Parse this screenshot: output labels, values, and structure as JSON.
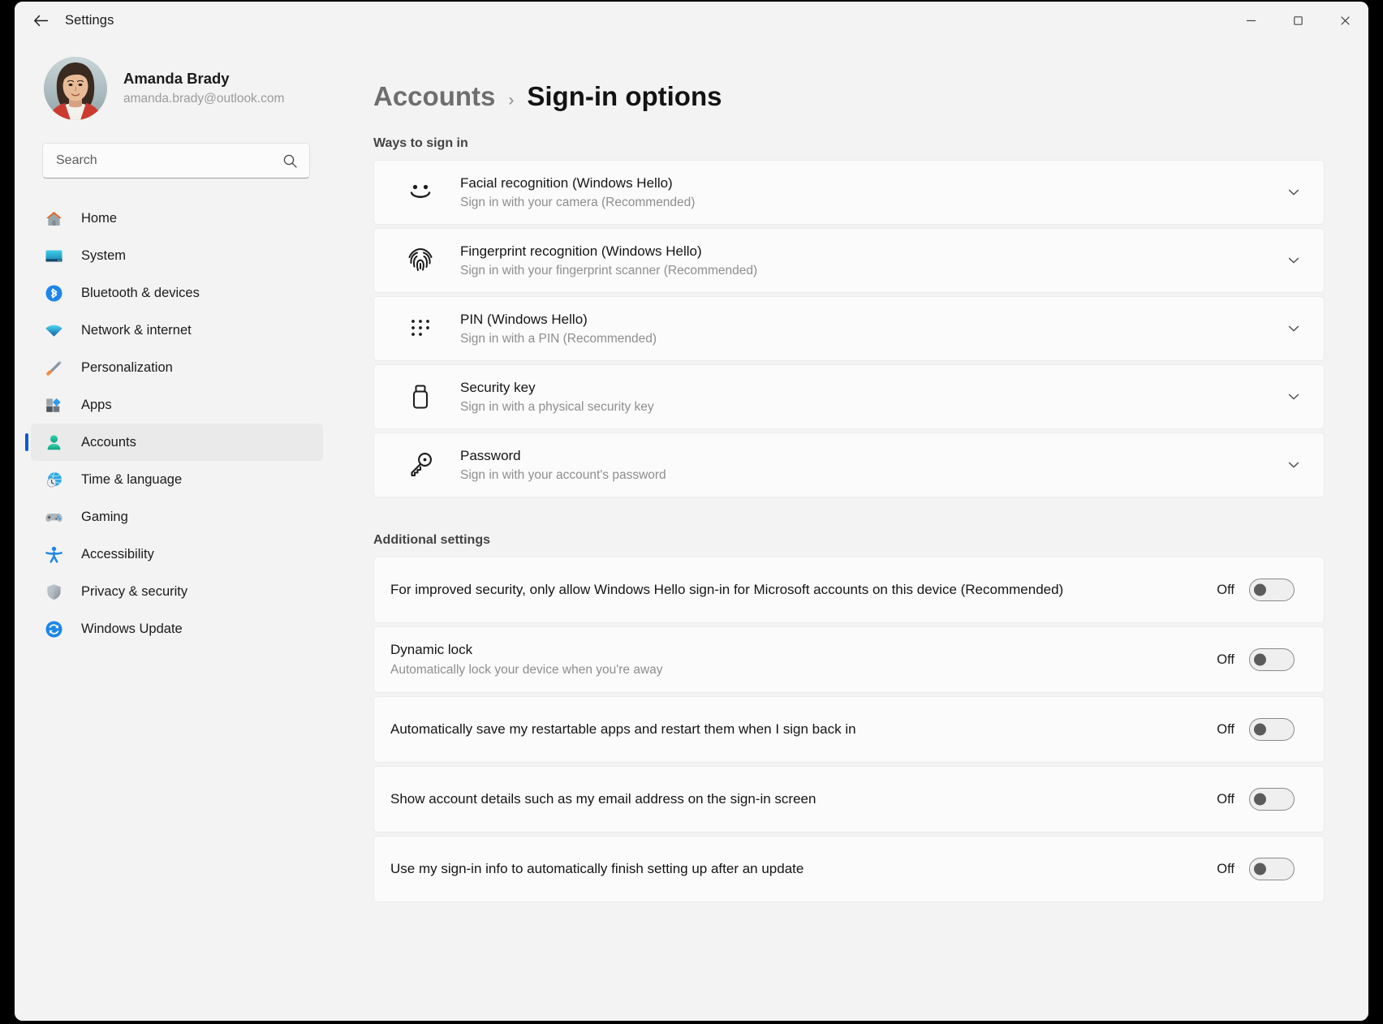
{
  "window": {
    "title": "Settings",
    "back_icon": "back-arrow-icon",
    "minimize_label": "Minimize",
    "maximize_label": "Maximize",
    "close_label": "Close"
  },
  "sidebar": {
    "profile": {
      "name": "Amanda Brady",
      "email": "amanda.brady@outlook.com"
    },
    "search": {
      "placeholder": "Search",
      "value": "",
      "icon": "search-icon"
    },
    "items": [
      {
        "label": "Home",
        "icon": "home-icon",
        "selected": false
      },
      {
        "label": "System",
        "icon": "monitor-icon",
        "selected": false
      },
      {
        "label": "Bluetooth & devices",
        "icon": "bluetooth-icon",
        "selected": false
      },
      {
        "label": "Network & internet",
        "icon": "wifi-icon",
        "selected": false
      },
      {
        "label": "Personalization",
        "icon": "paintbrush-icon",
        "selected": false
      },
      {
        "label": "Apps",
        "icon": "apps-icon",
        "selected": false
      },
      {
        "label": "Accounts",
        "icon": "person-icon",
        "selected": true
      },
      {
        "label": "Time & language",
        "icon": "clock-globe-icon",
        "selected": false
      },
      {
        "label": "Gaming",
        "icon": "gamepad-icon",
        "selected": false
      },
      {
        "label": "Accessibility",
        "icon": "accessibility-icon",
        "selected": false
      },
      {
        "label": "Privacy & security",
        "icon": "shield-icon",
        "selected": false
      },
      {
        "label": "Windows Update",
        "icon": "update-refresh-icon",
        "selected": false
      }
    ]
  },
  "main": {
    "breadcrumb": {
      "parent": "Accounts",
      "separator": "›",
      "current": "Sign-in options"
    },
    "ways_section": {
      "heading": "Ways to sign in",
      "items": [
        {
          "title": "Facial recognition (Windows Hello)",
          "subtitle": "Sign in with your camera (Recommended)",
          "icon": "smiley-face-icon",
          "expand_icon": "chevron-down-icon"
        },
        {
          "title": "Fingerprint recognition (Windows Hello)",
          "subtitle": "Sign in with your fingerprint scanner (Recommended)",
          "icon": "fingerprint-icon",
          "expand_icon": "chevron-down-icon"
        },
        {
          "title": "PIN (Windows Hello)",
          "subtitle": "Sign in with a PIN (Recommended)",
          "icon": "pin-keypad-icon",
          "expand_icon": "chevron-down-icon"
        },
        {
          "title": "Security key",
          "subtitle": "Sign in with a physical security key",
          "icon": "usb-security-key-icon",
          "expand_icon": "chevron-down-icon"
        },
        {
          "title": "Password",
          "subtitle": "Sign in with your account's password",
          "icon": "key-icon",
          "expand_icon": "chevron-down-icon"
        }
      ]
    },
    "additional_section": {
      "heading": "Additional settings",
      "items": [
        {
          "title": "For improved security, only allow Windows Hello sign-in for Microsoft accounts on this device (Recommended)",
          "subtitle": "",
          "state": "Off",
          "on": false
        },
        {
          "title": "Dynamic lock",
          "subtitle": "Automatically lock your device when you're away",
          "state": "Off",
          "on": false
        },
        {
          "title": "Automatically save my restartable apps and restart them when I sign back in",
          "subtitle": "",
          "state": "Off",
          "on": false
        },
        {
          "title": "Show account details such as my email address on the sign-in screen",
          "subtitle": "",
          "state": "Off",
          "on": false
        },
        {
          "title": "Use my sign-in info to automatically finish setting up after an update",
          "subtitle": "",
          "state": "Off",
          "on": false
        }
      ]
    }
  },
  "colors": {
    "accent": "#0a5bd3",
    "window_bg": "#f3f3f3",
    "card_bg": "#fbfbfb",
    "text_primary": "#151515",
    "text_secondary": "#8e8e8e"
  }
}
